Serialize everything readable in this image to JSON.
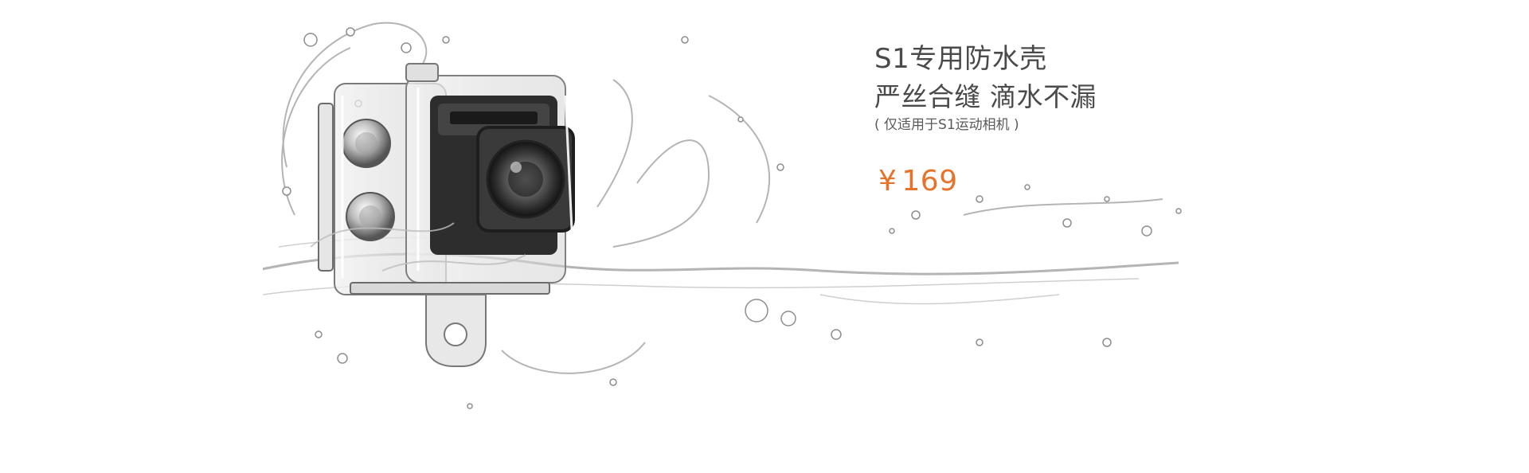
{
  "banner": {
    "product_name": "S1专用防水壳",
    "tagline": "严丝合缝 滴水不漏",
    "compatibility_note": "( 仅适用于S1运动相机 )",
    "price_currency": "¥",
    "price_value": "169"
  },
  "product_image": {
    "alt": "S1 waterproof case with action camera and water splash",
    "icon": "waterproof-case-illustration"
  },
  "colors": {
    "text": "#4a4a4a",
    "price": "#e8722a",
    "background": "#ffffff"
  }
}
